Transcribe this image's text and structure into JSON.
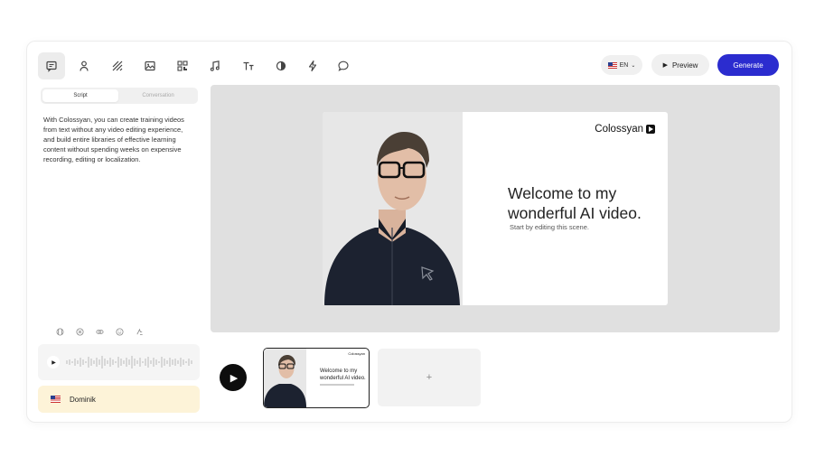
{
  "toolbar": {
    "tools": [
      {
        "name": "script-tool-icon",
        "active": true
      },
      {
        "name": "avatar-tool-icon"
      },
      {
        "name": "background-tool-icon"
      },
      {
        "name": "media-tool-icon"
      },
      {
        "name": "qr-code-tool-icon"
      },
      {
        "name": "music-tool-icon"
      },
      {
        "name": "text-tool-icon"
      },
      {
        "name": "shape-tool-icon"
      },
      {
        "name": "animation-tool-icon"
      },
      {
        "name": "comment-tool-icon"
      }
    ],
    "language_label": "EN",
    "preview_label": "Preview",
    "generate_label": "Generate"
  },
  "left_panel": {
    "tabs": [
      "Script",
      "Conversation"
    ],
    "active_tab": "Script",
    "script_text": "With Colossyan, you can create training videos from text without any video editing experience, and build entire libraries of effective learning content without spending weeks on expensive recording, editing or localization.",
    "voice_name": "Dominik"
  },
  "slide": {
    "logo_text": "Colossyan",
    "title": "Welcome to my wonderful AI video.",
    "subtitle": "Start by editing this scene."
  },
  "timeline": {
    "thumb_logo": "Colossyan",
    "thumb_title": "Welcome to my wonderful AI video.",
    "add_label": "+"
  },
  "colors": {
    "accent": "#2b2ccf",
    "voice_bg": "#fdf3d8",
    "canvas_bg": "#e0e0e0"
  }
}
